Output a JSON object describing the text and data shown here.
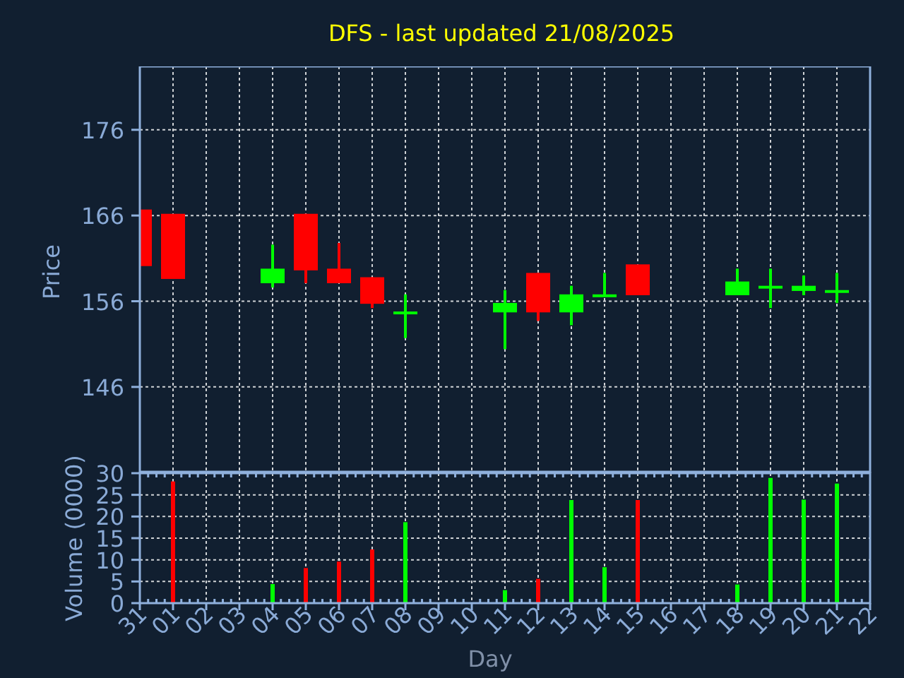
{
  "title": "DFS - last updated 21/08/2025",
  "price_chart": {
    "chart_data": {
      "type": "candlestick",
      "ylabel": "Price",
      "ylim": [
        136.1,
        183.4
      ],
      "yticks": [
        146,
        156,
        166,
        176
      ],
      "grid": true,
      "ohlc": [
        [
          166.7,
          166.7,
          160.1,
          160.1
        ],
        [
          166.2,
          166.2,
          158.6,
          158.6
        ],
        null,
        null,
        [
          158.1,
          162.6,
          157.6,
          159.8
        ],
        [
          166.2,
          166.2,
          158.1,
          159.6
        ],
        [
          159.8,
          162.8,
          158.1,
          158.1
        ],
        [
          158.8,
          158.8,
          155.2,
          155.7
        ],
        [
          154.6,
          156.8,
          151.7,
          154.8
        ],
        null,
        null,
        [
          154.7,
          157.3,
          150.4,
          155.8
        ],
        [
          159.3,
          159.3,
          153.7,
          154.7
        ],
        [
          154.7,
          157.8,
          153.2,
          156.8
        ],
        [
          156.6,
          159.3,
          156.6,
          156.8
        ],
        [
          160.3,
          160.3,
          156.7,
          156.7
        ],
        null,
        null,
        [
          156.7,
          159.8,
          156.7,
          158.3
        ],
        [
          157.6,
          159.8,
          155.2,
          157.8
        ],
        [
          157.2,
          159.0,
          156.7,
          157.8
        ],
        [
          157.2,
          159.3,
          155.8,
          157.3
        ],
        null
      ]
    }
  },
  "volume_chart": {
    "chart_data": {
      "type": "bar",
      "xlabel": "Day",
      "ylabel": "Volume (0000)",
      "categories": [
        "31",
        "01",
        "02",
        "03",
        "04",
        "05",
        "06",
        "07",
        "08",
        "09",
        "10",
        "11",
        "12",
        "13",
        "14",
        "15",
        "16",
        "17",
        "18",
        "19",
        "20",
        "21",
        "22"
      ],
      "ylim": [
        0,
        30
      ],
      "yticks": [
        0,
        5,
        10,
        15,
        20,
        25,
        30
      ],
      "grid": true,
      "values": [
        null,
        28.1,
        null,
        null,
        4.4,
        8.1,
        9.6,
        12.4,
        18.7,
        null,
        null,
        3.0,
        5.6,
        23.8,
        8.3,
        23.8,
        null,
        null,
        4.3,
        28.9,
        23.9,
        27.6,
        null
      ]
    }
  }
}
